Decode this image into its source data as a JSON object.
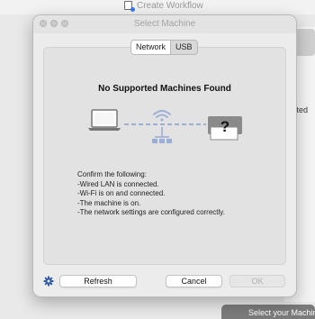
{
  "background": {
    "create_workflow_label": "Create Workflow",
    "side_text": "ected",
    "bottom_button_label": "Select your Machine"
  },
  "dialog": {
    "title": "Select Machine",
    "tabs": [
      {
        "label": "Network",
        "active": true
      },
      {
        "label": "USB",
        "active": false
      }
    ],
    "heading": "No Supported Machines Found",
    "instructions": [
      "Confirm the following:",
      "-Wired LAN is connected.",
      "-Wi-Fi is on and connected.",
      "-The machine is on.",
      "-The network settings are configured correctly."
    ],
    "illustration_unknown_symbol": "?",
    "buttons": {
      "refresh": "Refresh",
      "cancel": "Cancel",
      "ok": "OK"
    }
  },
  "colors": {
    "accent_blue": "#3478f6",
    "network_dash": "#9aaed8",
    "device_gray": "#8a8a8a"
  },
  "icons": {
    "settings": "gear-icon",
    "wifi": "wifi-icon",
    "laptop": "laptop-icon",
    "machine": "unknown-machine-icon",
    "wired": "wired-network-icon"
  }
}
